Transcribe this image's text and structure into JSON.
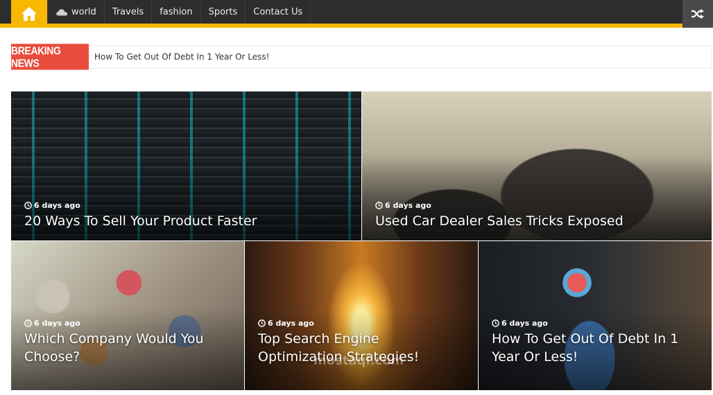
{
  "nav": {
    "items": [
      {
        "label": "world",
        "icon": "cloud-icon"
      },
      {
        "label": "Travels"
      },
      {
        "label": "fashion"
      },
      {
        "label": "Sports"
      },
      {
        "label": "Contact Us"
      }
    ],
    "home_icon": "home-icon",
    "random_icon": "shuffle-icon"
  },
  "breaking": {
    "label": "Breaking News",
    "headline": "How To Get Out Of Debt In 1 Year Or Less!"
  },
  "posts": [
    {
      "time": "6 days ago",
      "title": "20 Ways To Sell Your Product Faster"
    },
    {
      "time": "6 days ago",
      "title": "Used Car Dealer Sales Tricks Exposed"
    },
    {
      "time": "6 days ago",
      "title": "Which Company Would You Choose?"
    },
    {
      "time": "6 days ago",
      "title": "Top Search Engine Optimization Strategies!"
    },
    {
      "time": "6 days ago",
      "title": "How To Get Out Of Debt In 1 Year Or Less!"
    }
  ],
  "watermark": "mostaql.com",
  "colors": {
    "accent": "#f8b800",
    "breaking": "#e74c3c",
    "nav_bg": "#2d2d2d"
  }
}
